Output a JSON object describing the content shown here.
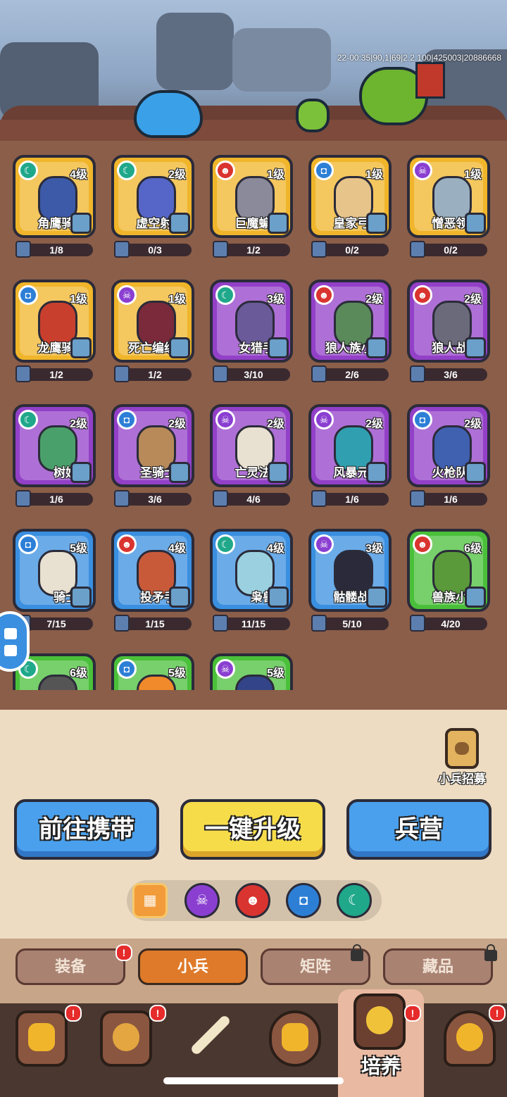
{
  "scene": {
    "debug_text": "22-00:35|90,1|69|2.2.100|425003|20886668"
  },
  "units": [
    {
      "name": "角鹰骑:",
      "level": "4级",
      "progress": "1/8",
      "faction": "moon",
      "bg": "gold"
    },
    {
      "name": "虚空射:",
      "level": "2级",
      "progress": "0/3",
      "faction": "moon",
      "bg": "gold"
    },
    {
      "name": "巨魔蝙:",
      "level": "1级",
      "progress": "1/2",
      "faction": "demon",
      "bg": "gold"
    },
    {
      "name": "皇家弓:",
      "level": "1级",
      "progress": "0/2",
      "faction": "helm",
      "bg": "gold"
    },
    {
      "name": "憎恶领:",
      "level": "1级",
      "progress": "0/2",
      "faction": "skull",
      "bg": "gold"
    },
    {
      "name": "龙鹰骑:",
      "level": "1级",
      "progress": "1/2",
      "faction": "helm",
      "bg": "gold"
    },
    {
      "name": "死亡编织",
      "level": "1级",
      "progress": "1/2",
      "faction": "skull",
      "bg": "gold"
    },
    {
      "name": "女猎手",
      "level": "3级",
      "progress": "3/10",
      "faction": "moon",
      "bg": "purple"
    },
    {
      "name": "狼人族小",
      "level": "2级",
      "progress": "2/6",
      "faction": "demon",
      "bg": "purple"
    },
    {
      "name": "狼人战:",
      "level": "2级",
      "progress": "3/6",
      "faction": "demon",
      "bg": "purple"
    },
    {
      "name": "树妖",
      "level": "2级",
      "progress": "1/6",
      "faction": "moon",
      "bg": "purple"
    },
    {
      "name": "圣骑士",
      "level": "2级",
      "progress": "3/6",
      "faction": "helm",
      "bg": "purple"
    },
    {
      "name": "亡灵法:",
      "level": "2级",
      "progress": "4/6",
      "faction": "skull",
      "bg": "purple"
    },
    {
      "name": "风暴元:",
      "level": "2级",
      "progress": "1/6",
      "faction": "skull",
      "bg": "purple"
    },
    {
      "name": "火枪队:",
      "level": "2级",
      "progress": "1/6",
      "faction": "helm",
      "bg": "purple"
    },
    {
      "name": "骑士",
      "level": "5级",
      "progress": "7/15",
      "faction": "helm",
      "bg": "blue"
    },
    {
      "name": "投矛手",
      "level": "4级",
      "progress": "1/15",
      "faction": "demon",
      "bg": "blue"
    },
    {
      "name": "枭兽",
      "level": "4级",
      "progress": "11/15",
      "faction": "moon",
      "bg": "blue"
    },
    {
      "name": "骷髅战:",
      "level": "3级",
      "progress": "5/10",
      "faction": "skull",
      "bg": "blue"
    },
    {
      "name": "兽族小:",
      "level": "6级",
      "progress": "4/20",
      "faction": "demon",
      "bg": "green"
    },
    {
      "name": "",
      "level": "6级",
      "progress": "",
      "faction": "moon",
      "bg": "green"
    },
    {
      "name": "",
      "level": "5级",
      "progress": "",
      "faction": "helm",
      "bg": "green"
    },
    {
      "name": "",
      "level": "5级",
      "progress": "",
      "faction": "skull",
      "bg": "green"
    }
  ],
  "recruit": {
    "label": "小兵招募"
  },
  "actions": {
    "carry": "前往携带",
    "upgrade_all": "一键升级",
    "barracks": "兵营"
  },
  "filters": [
    {
      "key": "all",
      "icon": "grid-icon"
    },
    {
      "key": "skull",
      "icon": "skull-icon"
    },
    {
      "key": "demon",
      "icon": "demon-icon"
    },
    {
      "key": "helm",
      "icon": "helm-icon"
    },
    {
      "key": "moon",
      "icon": "moon-icon"
    }
  ],
  "subtabs": [
    {
      "label": "装备",
      "state": "alert"
    },
    {
      "label": "小兵",
      "state": "active"
    },
    {
      "label": "矩阵",
      "state": "locked"
    },
    {
      "label": "藏品",
      "state": "locked"
    }
  ],
  "nav": {
    "active_label": "培养",
    "alert_mark": "!"
  },
  "colors": {
    "gold": "#f0b52a",
    "purple": "#9340c8",
    "blue": "#3a8fe0",
    "green": "#4ac03a",
    "active_tab": "#de7a2a"
  }
}
